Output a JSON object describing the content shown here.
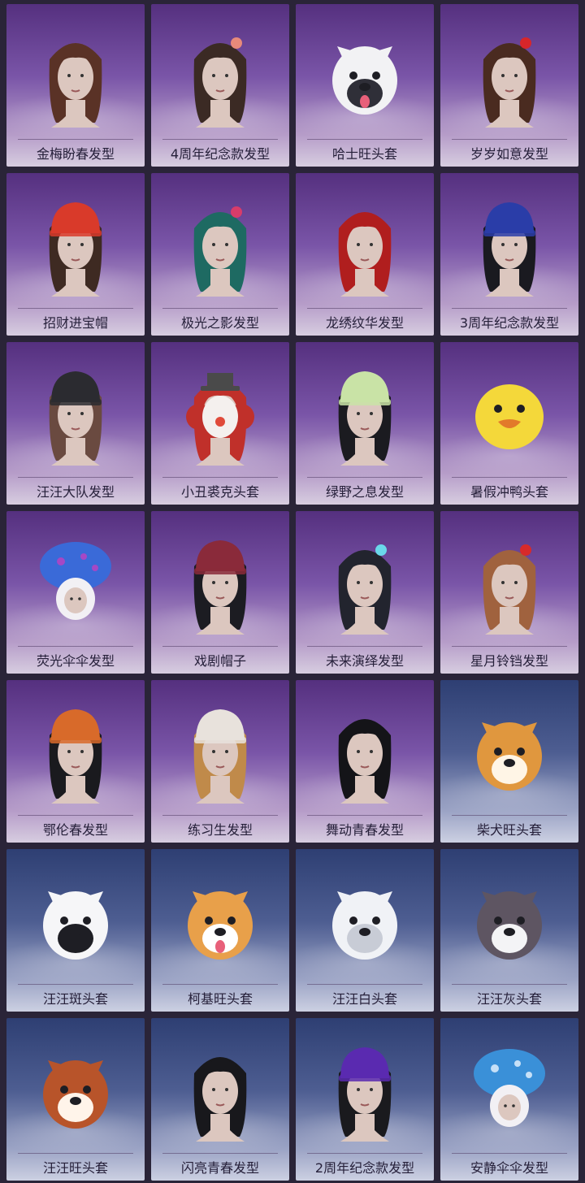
{
  "items": [
    {
      "name": "金梅盼春发型",
      "kind": "hair",
      "hair_color": "#5a3226"
    },
    {
      "name": "4周年纪念款发型",
      "kind": "hair",
      "hair_color": "#3b2a24",
      "accent": "#e88a7a"
    },
    {
      "name": "哈士旺头套",
      "kind": "dog",
      "fur": "#f2f2f4",
      "mark": "#2f2f38",
      "tongue": true
    },
    {
      "name": "岁岁如意发型",
      "kind": "hair",
      "hair_color": "#4a2b20",
      "accent": "#d8262a"
    },
    {
      "name": "招财进宝帽",
      "kind": "hat",
      "hair_color": "#3e2a22",
      "hat": "#d93a2a"
    },
    {
      "name": "极光之影发型",
      "kind": "hair",
      "hair_color": "#1e6a62",
      "accent": "#d83c6a"
    },
    {
      "name": "龙绣纹华发型",
      "kind": "hair",
      "hair_color": "#b01e1e"
    },
    {
      "name": "3周年纪念款发型",
      "kind": "hat",
      "hair_color": "#1a1a20",
      "hat": "#2a3da8"
    },
    {
      "name": "汪汪大队发型",
      "kind": "hat",
      "hair_color": "#6a4a40",
      "hat": "#2b2b30"
    },
    {
      "name": "小丑裘克头套",
      "kind": "clown",
      "hair_color": "#c0302a",
      "hat": "#4a4a4a"
    },
    {
      "name": "绿野之息发型",
      "kind": "hat",
      "hair_color": "#1b1b20",
      "hat": "#c9e3a6"
    },
    {
      "name": "暑假冲鸭头套",
      "kind": "duck",
      "fur": "#f4d83a",
      "mark": "#e27a2a"
    },
    {
      "name": "荧光伞伞发型",
      "kind": "mushroom",
      "cap": "#3a6ad8",
      "accent": "#c040c0"
    },
    {
      "name": "戏剧帽子",
      "kind": "hat",
      "hair_color": "#1c1c22",
      "hat": "#8a2a3a"
    },
    {
      "name": "未来演绎发型",
      "kind": "hair",
      "hair_color": "#22242e",
      "accent": "#6ad8ea"
    },
    {
      "name": "星月铃铛发型",
      "kind": "hair",
      "hair_color": "#a0623e",
      "accent": "#d82a2a"
    },
    {
      "name": "鄂伦春发型",
      "kind": "hat",
      "hair_color": "#1a1a1e",
      "hat": "#d86a2a"
    },
    {
      "name": "练习生发型",
      "kind": "hat",
      "hair_color": "#c08a4a",
      "hat": "#e8e2dc"
    },
    {
      "name": "舞动青春发型",
      "kind": "hair",
      "hair_color": "#141418"
    },
    {
      "name": "柴犬旺头套",
      "kind": "dog",
      "fur": "#e0973e",
      "mark": "#fff5e6",
      "tongue": false
    },
    {
      "name": "汪汪斑头套",
      "kind": "dog",
      "fur": "#f6f6f8",
      "mark": "#1e1e24",
      "tongue": false
    },
    {
      "name": "柯基旺头套",
      "kind": "dog",
      "fur": "#e8a04a",
      "mark": "#ffffff",
      "tongue": true
    },
    {
      "name": "汪汪白头套",
      "kind": "dog",
      "fur": "#f0f2f6",
      "mark": "#c8ccd6",
      "tongue": false
    },
    {
      "name": "汪汪灰头套",
      "kind": "dog",
      "fur": "#5e5562",
      "mark": "#f4f4f6",
      "tongue": false
    },
    {
      "name": "汪汪旺头套",
      "kind": "dog",
      "fur": "#b8542a",
      "mark": "#fff4ea",
      "tongue": false
    },
    {
      "name": "闪亮青春发型",
      "kind": "hair",
      "hair_color": "#18181c"
    },
    {
      "name": "2周年纪念款发型",
      "kind": "hat",
      "hair_color": "#1a1a1e",
      "hat": "#5a2ab0"
    },
    {
      "name": "安静伞伞发型",
      "kind": "mushroom",
      "cap": "#3a90d8",
      "accent": "#eaf4ff"
    }
  ]
}
